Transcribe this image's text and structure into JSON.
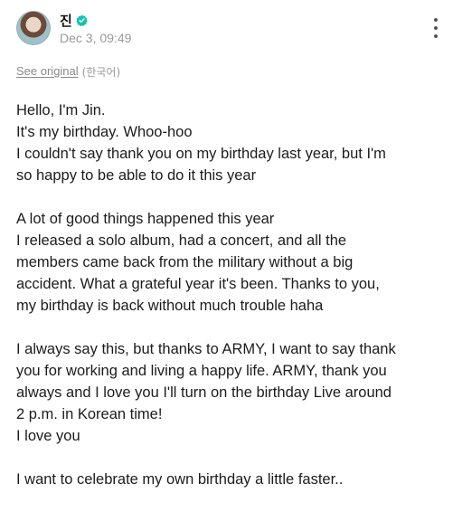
{
  "post": {
    "author": "진",
    "timestamp": "Dec 3, 09:49",
    "see_original": "See original",
    "original_language": "(한국어)",
    "paragraphs": [
      [
        "Hello, I'm Jin.",
        "It's my birthday. Whoo-hoo",
        "I couldn't say thank you on my birthday last year, but I'm",
        "so happy to be able to do it this year"
      ],
      [
        "A lot of good things happened this year",
        "I released a solo album, had a concert, and all the",
        "members came back from the military without a big",
        "accident. What a grateful year it's been. Thanks to you,",
        "my birthday is back without much trouble haha"
      ],
      [
        "I always say this, but thanks to ARMY, I want to say thank",
        "you for working and living a happy life. ARMY, thank you",
        "always and I love you I'll turn on the birthday Live around",
        "2 p.m. in Korean time!",
        "I love you"
      ],
      [
        "I want to celebrate my own birthday a little faster.."
      ]
    ]
  },
  "icons": {
    "verified": "verified-badge-icon",
    "more": "more-vertical-icon"
  },
  "colors": {
    "verified_badge": "#12c2b4",
    "meta_text": "#9a9a9a"
  }
}
